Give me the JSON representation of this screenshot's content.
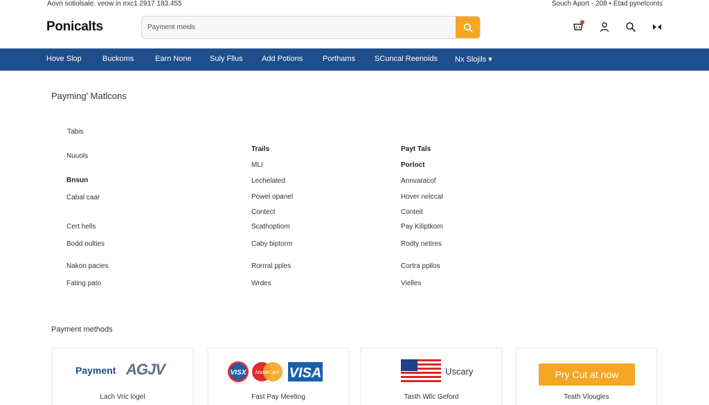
{
  "topbar": {
    "left_text": "Aovn sotiolsale. veow in exc1 2917 183.455",
    "right_text": "Souch Aport - 208 • Etad pynelconts"
  },
  "header": {
    "logo": "Ponicalts",
    "search_placeholder": "Payment meids",
    "icons": [
      "cart-icon",
      "user-icon",
      "search-icon",
      "play-icon"
    ]
  },
  "nav": {
    "items": [
      "Hove Slop",
      "Buckoms",
      "Earn None",
      "Suly Fllus",
      "Add Potions",
      "Porthams",
      "SCuncal Reenoids",
      "Nx Slojils ▾"
    ]
  },
  "main": {
    "title": "Payming' Matlcons",
    "col1": [
      "Tabis",
      "Nuuols",
      "Bnsun",
      "Cabal caar",
      "Cert hells",
      "Bodd oulties",
      "Nakon pacies",
      "Fating pato"
    ],
    "col2": [
      "Trails",
      "MLI",
      "Lechelated",
      "Powel opanel",
      "Contect",
      "Scathoptiom",
      "Caby biptorm",
      "Rorrral pples",
      "Wrdes"
    ],
    "col3": [
      "Payt Tals",
      "Porloct",
      "Annvaracof",
      "Hover nelccal",
      "Conteit",
      "Pay Kiliptkom",
      "Rodty netires",
      "Cortra ppllos",
      "Vielles"
    ]
  },
  "payment_methods": {
    "title": "Payment methods",
    "cards": [
      {
        "logo_text": "Payment",
        "logo_mark": "AGJV",
        "caption": "Lach Vric logel"
      },
      {
        "logos": [
          "VISX",
          "MasteCard",
          "VISA"
        ],
        "caption": "Fast Pay Meeting"
      },
      {
        "label": "Uscary",
        "caption": "Tasth Wllc Geford"
      },
      {
        "button_label": "Pry Cut at now",
        "caption": "Teath Vlougles"
      }
    ]
  },
  "colors": {
    "nav_bg": "#1f4e8c",
    "accent_orange": "#f5a623",
    "card_border": "#eeeeee"
  }
}
